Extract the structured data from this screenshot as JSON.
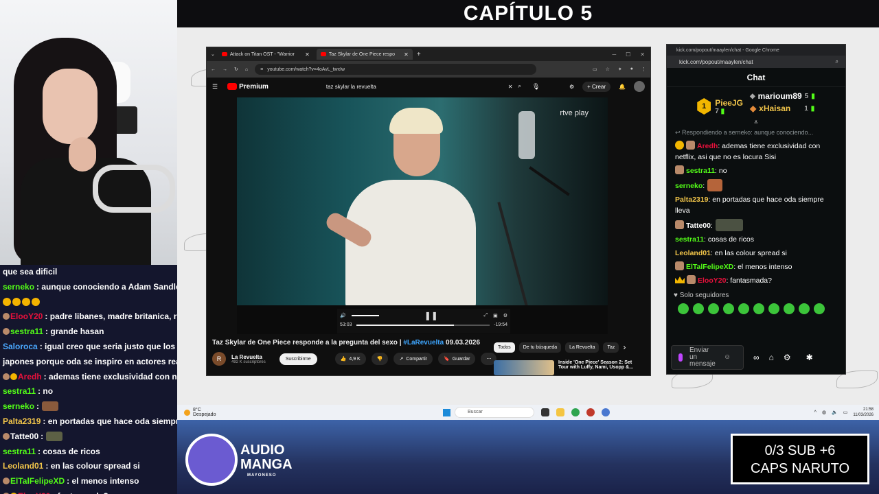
{
  "overlay": {
    "chapter_title": "CAPÍTULO 5",
    "goal_line1": "0/3 SUB   +6",
    "goal_line2": "CAPS NARUTO",
    "logo_line1": "AUDIO",
    "logo_line2": "MANGA",
    "logo_sub": "MAYONESO"
  },
  "left_chat": [
    {
      "name": "",
      "text": "que sea dificil",
      "color": "#ffffff",
      "badges": 0
    },
    {
      "name": "serneko",
      "text": ": aunque conociendo a Adam Sandler, l",
      "color": "#53fc18",
      "badges": 0
    },
    {
      "name": "",
      "text": "",
      "color": "#ffffff",
      "badges": 0,
      "emotes": 4
    },
    {
      "name": "ElooY20",
      "text": ": padre libanes, madre britanica, r",
      "color": "#e9113c",
      "badges": 1
    },
    {
      "name": "sestra11",
      "text": ": grande hasan",
      "color": "#53fc18",
      "badges": 1
    },
    {
      "name": "Saloroca",
      "text": ": igual creo que seria justo que los aln",
      "color": "#4aa8ff",
      "badges": 0
    },
    {
      "name": "",
      "text": "japones porque oda se inspiro en actores reales",
      "color": "#ffffff",
      "badges": 0
    },
    {
      "name": "Aredh",
      "text": ": ademas tiene exclusividad con net",
      "color": "#e9113c",
      "badges": 2
    },
    {
      "name": "sestra11",
      "text": ": no",
      "color": "#53fc18",
      "badges": 0
    },
    {
      "name": "serneko",
      "text": ":",
      "color": "#53fc18",
      "badges": 0,
      "img": "brown"
    },
    {
      "name": "Palta2319",
      "text": ": en portadas que hace oda siempre",
      "color": "#f3c64a",
      "badges": 0
    },
    {
      "name": "Tatte00",
      "text": ":",
      "color": "#ffffff",
      "badges": 1,
      "img": "gray"
    },
    {
      "name": "sestra11",
      "text": ": cosas de ricos",
      "color": "#53fc18",
      "badges": 0
    },
    {
      "name": "Leoland01",
      "text": ": en las colour spread si",
      "color": "#f3c64a",
      "badges": 0
    },
    {
      "name": "ElTalFelipeXD",
      "text": ": el menos intenso",
      "color": "#53fc18",
      "badges": 1
    },
    {
      "name": "ElooY20",
      "text": ": fantasmada?",
      "color": "#e9113c",
      "badges": 2
    }
  ],
  "browser": {
    "tab1": "Attack on Titan OST - \"Warrior",
    "tab2": "Taz Skylar de One Piece respo",
    "url": "youtube.com/watch?v=4oAvL_twxIw",
    "yt_brand": "Premium",
    "search_value": "taz skylar la revuelta",
    "create_label": "Crear",
    "channel_watermark": "rtve play",
    "time_current": "53:03",
    "time_remaining": "-19:54",
    "progress": 0.73,
    "title_main": "Taz Skylar de One Piece responde a la pregunta del sexo | ",
    "title_hash": "#LaRevuelta",
    "title_date": " 09.03.2026",
    "channel_name": "La Revuelta",
    "channel_subs": "492 K suscriptores",
    "subscribe_label": "Suscribirme",
    "likes": "4,9 K",
    "share_label": "Compartir",
    "save_label": "Guardar",
    "chips": [
      "Todos",
      "De tu búsqueda",
      "La Revuelta",
      "Taz"
    ],
    "rec_title_line1": "Inside 'One Piece' Season 2: Set",
    "rec_title_line2": "Tour with Luffy, Nami, Usopp &..."
  },
  "taskbar": {
    "temp": "8°C",
    "weather": "Despejado",
    "search_placeholder": "Buscar",
    "time": "21:58",
    "date": "11/03/2026"
  },
  "kick_chat": {
    "window_title": "kick.com/popout/maaylen/chat - Google Chrome",
    "url": "kick.com/popout/maaylen/chat",
    "header": "Chat",
    "top1_name": "PieeJG",
    "top1_rank": "1",
    "top1_count": "7",
    "top2_name": "marioum89",
    "top2_count": "5",
    "top3_name": "xHaisan",
    "top3_count": "1",
    "reply_note": "Respondiendo a serneko: aunque conociendo...",
    "messages": [
      {
        "name": "Aredh",
        "text": ": ademas tiene exclusividad con netflix, asi que no es locura Sisi",
        "color": "#e9113c"
      },
      {
        "name": "sestra11",
        "text": ": no",
        "color": "#53fc18"
      },
      {
        "name": "serneko",
        "text": ":",
        "color": "#53fc18"
      },
      {
        "name": "Palta2319",
        "text": ": en portadas que hace oda siempre lleva",
        "color": "#f3c64a"
      },
      {
        "name": "Tatte00",
        "text": ":",
        "color": "#ffffff"
      },
      {
        "name": "sestra11",
        "text": ": cosas de ricos",
        "color": "#53fc18"
      },
      {
        "name": "Leoland01",
        "text": ": en las colour spread si",
        "color": "#f3c64a"
      },
      {
        "name": "ElTalFelipeXD",
        "text": ": el menos intenso",
        "color": "#53fc18"
      },
      {
        "name": "ElooY20",
        "text": ": fantasmada?",
        "color": "#e9113c"
      }
    ],
    "followers_only": "Solo seguidores",
    "input_placeholder": "Enviar un mensaje"
  }
}
